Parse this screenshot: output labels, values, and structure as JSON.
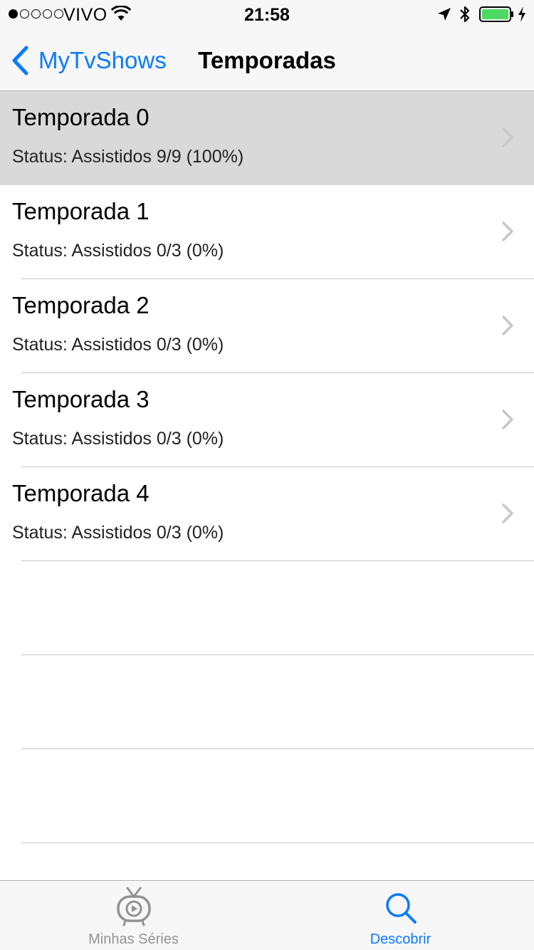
{
  "status_bar": {
    "carrier": "VIVO",
    "time": "21:58",
    "signal_dots_filled": 1,
    "signal_dots_total": 5,
    "battery_color": "#4cd964",
    "icons": [
      "wifi-icon",
      "location-arrow-icon",
      "bluetooth-icon",
      "battery-icon",
      "charging-bolt-icon"
    ]
  },
  "nav": {
    "back_label": "MyTvShows",
    "title": "Temporadas",
    "accent": "#0a7aff"
  },
  "seasons": [
    {
      "title": "Temporada 0",
      "status": "Status: Assistidos 9/9 (100%)",
      "selected": true
    },
    {
      "title": "Temporada 1",
      "status": "Status: Assistidos 0/3 (0%)",
      "selected": false
    },
    {
      "title": "Temporada 2",
      "status": "Status: Assistidos 0/3 (0%)",
      "selected": false
    },
    {
      "title": "Temporada 3",
      "status": "Status: Assistidos 0/3 (0%)",
      "selected": false
    },
    {
      "title": "Temporada 4",
      "status": "Status: Assistidos 0/3 (0%)",
      "selected": false
    }
  ],
  "tab_bar": {
    "tabs": [
      {
        "label": "Minhas Séries",
        "icon": "tv-icon",
        "active": false
      },
      {
        "label": "Descobrir",
        "icon": "search-icon",
        "active": true
      }
    ],
    "active_color": "#0a7aff",
    "inactive_color": "#929292"
  }
}
